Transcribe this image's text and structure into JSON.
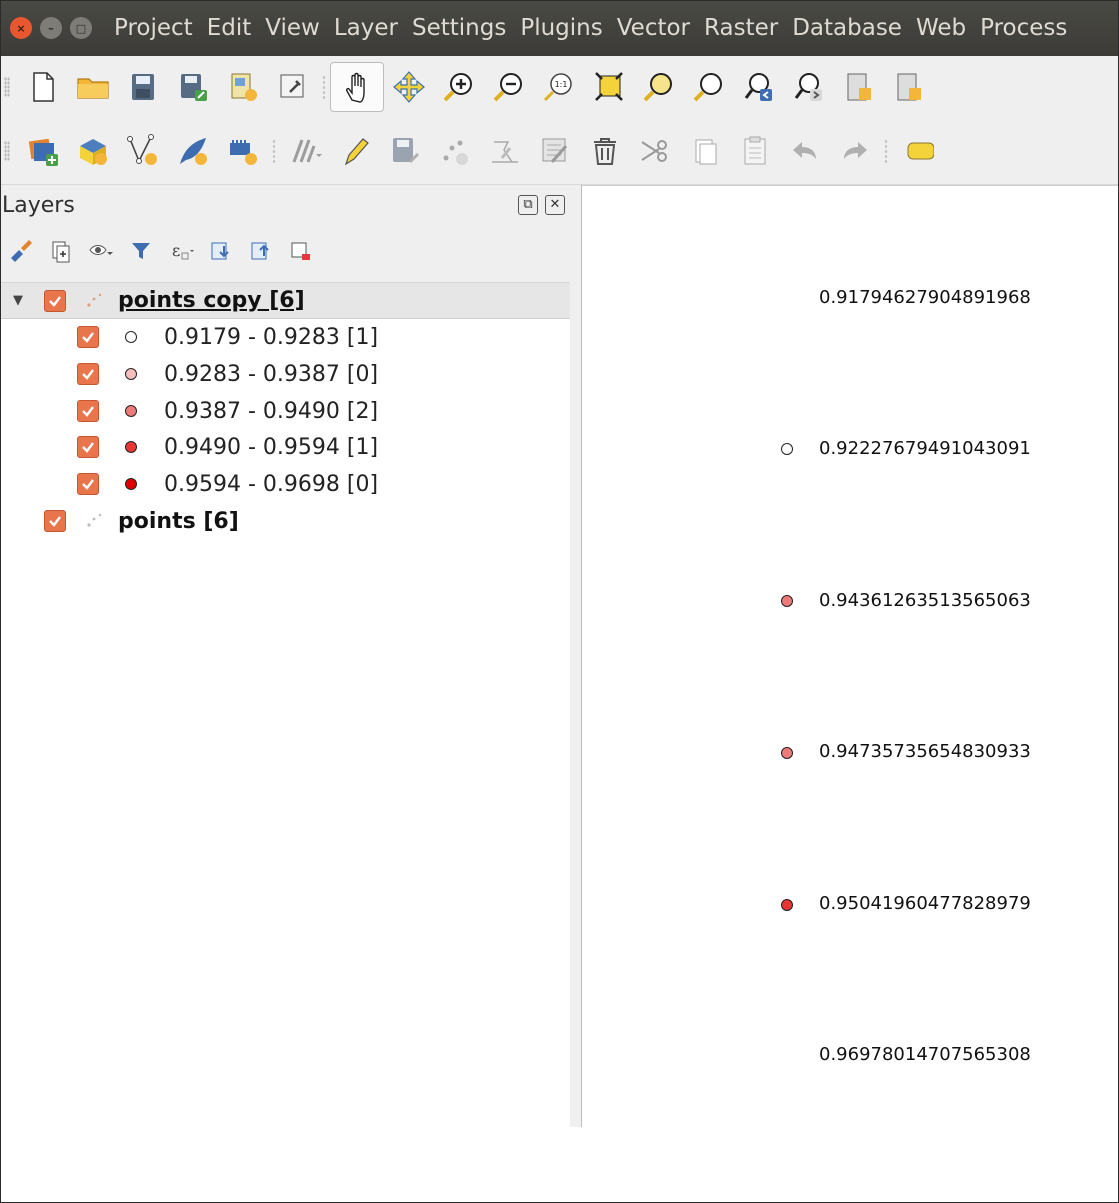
{
  "window": {
    "buttons": [
      {
        "name": "close-window-button",
        "glyph": "×"
      },
      {
        "name": "minimize-window-button",
        "glyph": "–"
      },
      {
        "name": "maximize-window-button",
        "glyph": "□"
      }
    ]
  },
  "menubar": {
    "items": [
      "Project",
      "Edit",
      "View",
      "Layer",
      "Settings",
      "Plugins",
      "Vector",
      "Raster",
      "Database",
      "Web",
      "Process"
    ]
  },
  "toolbar1": {
    "icons": [
      "new-project-icon",
      "open-project-icon",
      "save-project-icon",
      "save-as-icon",
      "new-print-layout-icon",
      "layout-manager-icon",
      "pan-map-icon",
      "pan-to-selection-icon",
      "zoom-in-icon",
      "zoom-out-icon",
      "zoom-native-icon",
      "zoom-full-icon",
      "zoom-to-selection-icon",
      "zoom-to-layer-icon",
      "zoom-last-icon",
      "zoom-next-icon",
      "new-bookmark-icon",
      "show-bookmarks-icon"
    ]
  },
  "toolbar2": {
    "icons": [
      "data-source-manager-icon",
      "new-geopackage-layer-icon",
      "new-shapefile-layer-icon",
      "new-spatialite-layer-icon",
      "new-virtual-layer-icon",
      "current-edits-icon",
      "toggle-editing-icon",
      "save-edits-icon",
      "digitize-icon",
      "vertex-tool-icon",
      "modify-attributes-icon",
      "delete-selected-icon",
      "cut-features-icon",
      "copy-features-icon",
      "paste-features-icon",
      "undo-icon",
      "redo-icon",
      "label-toolbar-icon"
    ]
  },
  "layers_panel": {
    "title": "Layers",
    "float_glyph": "⧉",
    "close_glyph": "✕",
    "tools": [
      "open-styling-icon",
      "add-group-icon",
      "manage-visibility-icon",
      "filter-legend-icon",
      "filter-by-expression-icon",
      "expand-all-icon",
      "collapse-all-icon",
      "remove-layer-icon"
    ],
    "layers": [
      {
        "label": "points copy [6]",
        "checked": true,
        "expanded": true,
        "current": true,
        "classes": [
          {
            "label": "0.9179 - 0.9283  [1]",
            "color": "#ffffff"
          },
          {
            "label": "0.9283 - 0.9387  [0]",
            "color": "#f7bcbc"
          },
          {
            "label": "0.9387 - 0.9490  [2]",
            "color": "#ef7a7a"
          },
          {
            "label": "0.9490 - 0.9594  [1]",
            "color": "#e83434"
          },
          {
            "label": "0.9594 - 0.9698  [0]",
            "color": "#e00000"
          }
        ]
      },
      {
        "label": "points [6]",
        "checked": true,
        "expanded": false,
        "current": false,
        "classes": []
      }
    ]
  },
  "map": {
    "features": [
      {
        "label": "0.91794627904891968",
        "color": null
      },
      {
        "label": "0.92227679491043091",
        "color": "#ffffff"
      },
      {
        "label": "0.94361263513565063",
        "color": "#ef7a7a"
      },
      {
        "label": "0.94735735654830933",
        "color": "#ef7a7a"
      },
      {
        "label": "0.95041960477828979",
        "color": "#e83434"
      },
      {
        "label": "0.96978014707565308",
        "color": null
      }
    ]
  }
}
